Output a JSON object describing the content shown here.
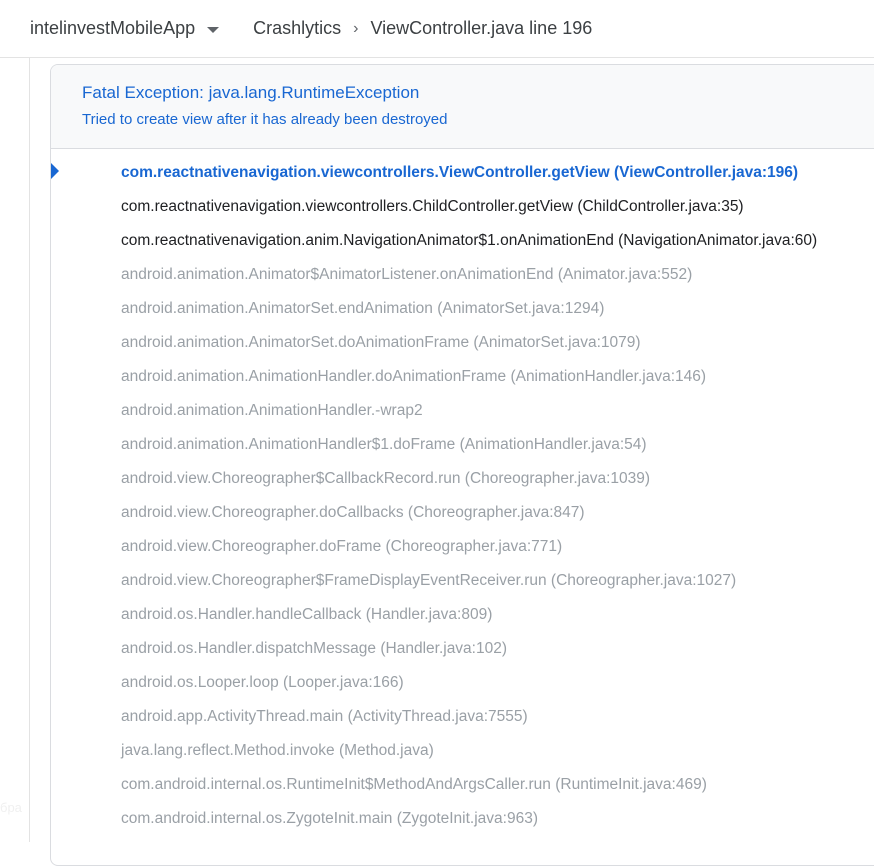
{
  "header": {
    "app_name": "intelinvestMobileApp",
    "breadcrumb_section": "Crashlytics",
    "breadcrumb_current": "ViewController.java line 196"
  },
  "rail": {
    "partial_text": "бра"
  },
  "exception": {
    "title": "Fatal Exception: java.lang.RuntimeException",
    "message": "Tried to create view after it has already been destroyed"
  },
  "stack_frames": [
    {
      "text": "com.reactnativenavigation.viewcontrollers.ViewController.getView (ViewController.java:196)",
      "kind": "primary"
    },
    {
      "text": "com.reactnativenavigation.viewcontrollers.ChildController.getView (ChildController.java:35)",
      "kind": "app"
    },
    {
      "text": "com.reactnativenavigation.anim.NavigationAnimator$1.onAnimationEnd (NavigationAnimator.java:60)",
      "kind": "app"
    },
    {
      "text": "android.animation.Animator$AnimatorListener.onAnimationEnd (Animator.java:552)",
      "kind": "system"
    },
    {
      "text": "android.animation.AnimatorSet.endAnimation (AnimatorSet.java:1294)",
      "kind": "system"
    },
    {
      "text": "android.animation.AnimatorSet.doAnimationFrame (AnimatorSet.java:1079)",
      "kind": "system"
    },
    {
      "text": "android.animation.AnimationHandler.doAnimationFrame (AnimationHandler.java:146)",
      "kind": "system"
    },
    {
      "text": "android.animation.AnimationHandler.-wrap2",
      "kind": "system"
    },
    {
      "text": "android.animation.AnimationHandler$1.doFrame (AnimationHandler.java:54)",
      "kind": "system"
    },
    {
      "text": "android.view.Choreographer$CallbackRecord.run (Choreographer.java:1039)",
      "kind": "system"
    },
    {
      "text": "android.view.Choreographer.doCallbacks (Choreographer.java:847)",
      "kind": "system"
    },
    {
      "text": "android.view.Choreographer.doFrame (Choreographer.java:771)",
      "kind": "system"
    },
    {
      "text": "android.view.Choreographer$FrameDisplayEventReceiver.run (Choreographer.java:1027)",
      "kind": "system"
    },
    {
      "text": "android.os.Handler.handleCallback (Handler.java:809)",
      "kind": "system"
    },
    {
      "text": "android.os.Handler.dispatchMessage (Handler.java:102)",
      "kind": "system"
    },
    {
      "text": "android.os.Looper.loop (Looper.java:166)",
      "kind": "system"
    },
    {
      "text": "android.app.ActivityThread.main (ActivityThread.java:7555)",
      "kind": "system"
    },
    {
      "text": "java.lang.reflect.Method.invoke (Method.java)",
      "kind": "system"
    },
    {
      "text": "com.android.internal.os.RuntimeInit$MethodAndArgsCaller.run (RuntimeInit.java:469)",
      "kind": "system"
    },
    {
      "text": "com.android.internal.os.ZygoteInit.main (ZygoteInit.java:963)",
      "kind": "system"
    }
  ],
  "colors": {
    "primary_frame": "#1967d2",
    "app_frame": "#202124",
    "system_frame": "#9aa0a6"
  }
}
